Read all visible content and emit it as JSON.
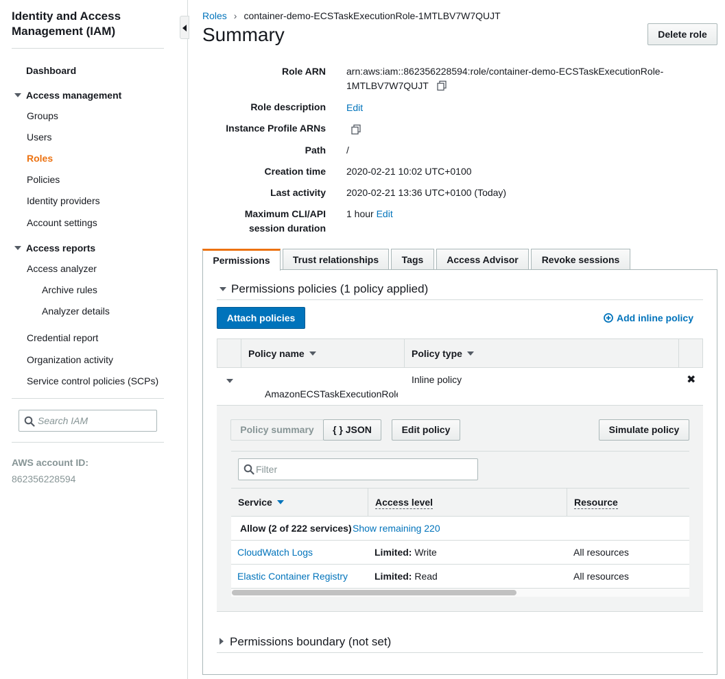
{
  "sidebar": {
    "title": "Identity and Access Management (IAM)",
    "dashboard": "Dashboard",
    "access_management": "Access management",
    "items_am": [
      "Groups",
      "Users",
      "Roles",
      "Policies",
      "Identity providers",
      "Account settings"
    ],
    "active_item": "Roles",
    "access_reports": "Access reports",
    "access_analyzer": "Access analyzer",
    "analyzer_sub": [
      "Archive rules",
      "Analyzer details"
    ],
    "reports_items": [
      "Credential report",
      "Organization activity",
      "Service control policies (SCPs)"
    ],
    "search_placeholder": "Search IAM",
    "account_id_label": "AWS account ID:",
    "account_id": "862356228594"
  },
  "breadcrumb": {
    "root": "Roles",
    "current": "container-demo-ECSTaskExecutionRole-1MTLBV7W7QUJT"
  },
  "page_title": "Summary",
  "delete_role_label": "Delete role",
  "summary": {
    "role_arn_label": "Role ARN",
    "role_arn_line1": "arn:aws:iam::862356228594:role/container-demo-ECSTaskExecutionRole-",
    "role_arn_line2": "1MTLBV7W7QUJT",
    "role_description_label": "Role description",
    "role_description_edit": "Edit",
    "instance_profile_label": "Instance Profile ARNs",
    "path_label": "Path",
    "path_value": "/",
    "creation_time_label": "Creation time",
    "creation_time_value": "2020-02-21 10:02 UTC+0100",
    "last_activity_label": "Last activity",
    "last_activity_value": "2020-02-21 13:36 UTC+0100 (Today)",
    "max_session_label_1": "Maximum CLI/API",
    "max_session_label_2": "session duration",
    "max_session_value": "1 hour",
    "max_session_edit": "Edit"
  },
  "tabs": [
    "Permissions",
    "Trust relationships",
    "Tags",
    "Access Advisor",
    "Revoke sessions"
  ],
  "permissions": {
    "policies_heading": "Permissions policies (1 policy applied)",
    "attach_button": "Attach policies",
    "add_inline": "Add inline policy",
    "col_policy_name": "Policy name",
    "col_policy_type": "Policy type",
    "policy_name": "AmazonECSTaskExecutionRole",
    "policy_type": "Inline policy",
    "btn_policy_summary": "Policy summary",
    "btn_json": "{ } JSON",
    "btn_edit_policy": "Edit policy",
    "btn_simulate": "Simulate policy",
    "filter_placeholder": "Filter",
    "col_service": "Service",
    "col_access_level": "Access level",
    "col_resource": "Resource",
    "allow_text": "Allow (2 of 222 services)",
    "show_remaining": "Show remaining 220",
    "rows": [
      {
        "service": "CloudWatch Logs",
        "level_bold": "Limited:",
        "level": "Write",
        "resource": "All resources"
      },
      {
        "service": "Elastic Container Registry",
        "level_bold": "Limited:",
        "level": "Read",
        "resource": "All resources"
      }
    ],
    "boundary_heading": "Permissions boundary (not set)"
  }
}
